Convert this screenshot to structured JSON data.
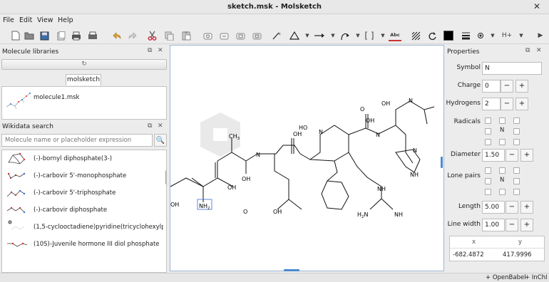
{
  "window": {
    "title": "sketch.msk - Molsketch"
  },
  "menu": [
    "File",
    "Edit",
    "View",
    "Help"
  ],
  "toolbar": {
    "icons": [
      "new-file-icon",
      "open-file-icon",
      "save-icon",
      "save-as-icon",
      "print-icon",
      "undo-icon",
      "redo-icon",
      "cut-icon",
      "copy-icon",
      "paste-icon",
      "zoom-in-icon",
      "zoom-out-icon",
      "zoom-reset-icon",
      "zoom-fit-icon",
      "bond-draw-icon",
      "ring-icon",
      "arrow-icon",
      "curved-arrow-icon",
      "bracket-icon",
      "text-icon",
      "hatch-icon",
      "rotate-icon",
      "color-swatch-icon",
      "line-width-icon",
      "charge-icon"
    ],
    "text_tool_label": "Abc",
    "hydrogen_label": "H+",
    "color": "#000000"
  },
  "libraries": {
    "title": "Molecule libraries",
    "tab": "molsketch",
    "items": [
      {
        "label": "molecule1.msk"
      }
    ]
  },
  "wikidata": {
    "title": "Wikidata search",
    "placeholder": "Molecule name or placeholder expression",
    "results": [
      {
        "label": "(-)-bornyl diphosphate(3-)"
      },
      {
        "label": "(-)-carbovir 5'-monophosphate"
      },
      {
        "label": "(-)-carbovir 5'-triphosphate"
      },
      {
        "label": "(-)-carbovir diphosphate"
      },
      {
        "label": "(1,5-cyclooctadiene)pyridine(tricyclohexylpho"
      },
      {
        "label": "(10S)-Juvenile hormone III diol phosphate"
      }
    ]
  },
  "canvas": {
    "atoms": {
      "oh_top1": "OH",
      "o_top1": "O",
      "n_top1": "N",
      "oh_top2": "OH",
      "ho_top": "HO",
      "n_mid1": "N",
      "n_mid2": "N",
      "n_mid3": "N",
      "ch3": "CH",
      "ch3_sub": "3",
      "oh_left": "OH",
      "oh_mid": "OH",
      "oh_mid2": "OH",
      "nh2": "NH",
      "nh2_sub": "2",
      "o_bottom": "O",
      "oh_bottom": "OH",
      "nh": "NH",
      "h2n": "H",
      "h2n_sub": "2",
      "h2n_n": "N",
      "nh_bottom": "NH",
      "n_ring": "N",
      "nh_ring": "NH"
    }
  },
  "properties": {
    "title": "Properties",
    "symbol_label": "Symbol",
    "symbol": "N",
    "charge_label": "Charge",
    "charge": "0",
    "hydrogens_label": "Hydrogens",
    "hydrogens": "2",
    "radicals_label": "Radicals",
    "radicals_center": "N",
    "diameter_label": "Diameter",
    "diameter": "1.50",
    "lonepairs_label": "Lone pairs",
    "lonepairs_center": "N",
    "length_label": "Length",
    "length": "5.00",
    "linewidth_label": "Line width",
    "linewidth": "1.00",
    "x_header": "x",
    "y_header": "y",
    "x_value": "-682.4872",
    "y_value": "417.9996",
    "minus": "−",
    "plus": "+"
  },
  "status": {
    "openbabel": "+ OpenBabel",
    "inchi": "+ InChI"
  }
}
